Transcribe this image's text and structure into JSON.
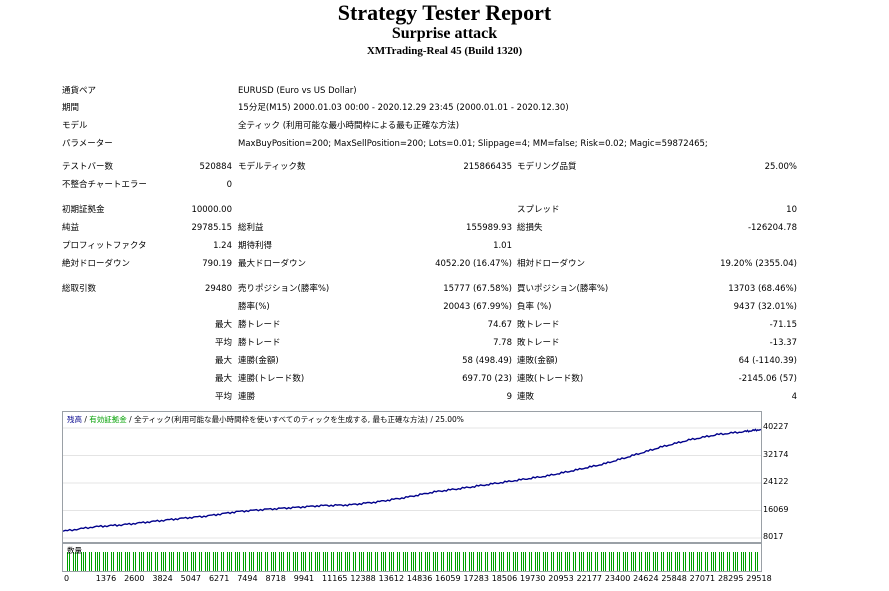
{
  "header": {
    "title": "Strategy Tester Report",
    "subtitle": "Surprise attack",
    "build": "XMTrading-Real 45 (Build 1320)"
  },
  "settings": {
    "symbol_label": "通貨ペア",
    "symbol_value": "EURUSD (Euro vs US Dollar)",
    "period_label": "期間",
    "period_value": "15分足(M15) 2000.01.03 00:00 - 2020.12.29 23:45 (2000.01.01 - 2020.12.30)",
    "model_label": "モデル",
    "model_value": "全ティック (利用可能な最小時間枠による最も正確な方法)",
    "params_label": "パラメーター",
    "params_value": "MaxBuyPosition=200; MaxSellPosition=200; Lots=0.01; Slippage=4; MM=false; Risk=0.02; Magic=59872465;"
  },
  "stats": {
    "bars_label": "テストバー数",
    "bars_value": "520884",
    "ticks_label": "モデルティック数",
    "ticks_value": "215866435",
    "quality_label": "モデリング品質",
    "quality_value": "25.00%",
    "mismatch_label": "不整合チャートエラー",
    "mismatch_value": "0",
    "deposit_label": "初期証拠金",
    "deposit_value": "10000.00",
    "spread_label": "スプレッド",
    "spread_value": "10",
    "netprofit_label": "純益",
    "netprofit_value": "29785.15",
    "grossprofit_label": "総利益",
    "grossprofit_value": "155989.93",
    "grossloss_label": "総損失",
    "grossloss_value": "-126204.78",
    "pf_label": "プロフィットファクタ",
    "pf_value": "1.24",
    "expected_label": "期待利得",
    "expected_value": "1.01",
    "absdd_label": "絶対ドローダウン",
    "absdd_value": "790.19",
    "maxdd_label": "最大ドローダウン",
    "maxdd_value": "4052.20 (16.47%)",
    "reldd_label": "相対ドローダウン",
    "reldd_value": "19.20% (2355.04)",
    "trades_label": "総取引数",
    "trades_value": "29480",
    "short_label": "売りポジション(勝率%)",
    "short_value": "15777 (67.58%)",
    "long_label": "買いポジション(勝率%)",
    "long_value": "13703 (68.46%)",
    "winrate_label": "勝率(%)",
    "winrate_value": "20043 (67.99%)",
    "lossrate_label": "負率 (%)",
    "lossrate_value": "9437 (32.01%)",
    "pre_max": "最大",
    "pre_avg": "平均",
    "largest_win_label": "勝トレード",
    "largest_win_value": "74.67",
    "largest_loss_label": "敗トレード",
    "largest_loss_value": "-71.15",
    "avg_win_label": "勝トレード",
    "avg_win_value": "7.78",
    "avg_loss_label": "敗トレード",
    "avg_loss_value": "-13.37",
    "max_consec_wins_label": "連勝(金額)",
    "max_consec_wins_value": "58 (498.49)",
    "max_consec_losses_label": "連敗(金額)",
    "max_consec_losses_value": "64 (-1140.39)",
    "max_consec_profit_label": "連勝(トレード数)",
    "max_consec_profit_value": "697.70 (23)",
    "max_consec_loss_label": "連敗(トレード数)",
    "max_consec_loss_value": "-2145.06 (57)",
    "avg_consec_wins_label": "連勝",
    "avg_consec_wins_value": "9",
    "avg_consec_losses_label": "連敗",
    "avg_consec_losses_value": "4"
  },
  "chart_legend": {
    "balance": "残高",
    "sep1": " / ",
    "equity": "有効証拠金",
    "sep2": " / ",
    "model": "全ティック(利用可能な最小時間枠を使いすべてのティックを生成する, 最も正確な方法)",
    "sep3": " / ",
    "quality": "25.00%"
  },
  "volume_label": "数量",
  "colors": {
    "balance": "#00008b",
    "volume": "#00a000",
    "border": "#9aa0a6"
  },
  "chart_data": {
    "type": "line",
    "series": [
      {
        "name": "残高",
        "x": [
          0,
          1376,
          2600,
          3824,
          5047,
          6271,
          7494,
          8718,
          9941,
          11165,
          12388,
          13612,
          14836,
          16059,
          17283,
          18506,
          19730,
          20953,
          22177,
          23400,
          24624,
          25848,
          27071,
          28295,
          29518,
          30200
        ],
        "y": [
          10000,
          11300,
          11900,
          12800,
          13700,
          14500,
          15700,
          16400,
          16900,
          17500,
          17700,
          18600,
          19900,
          21500,
          22600,
          23800,
          25000,
          26200,
          27900,
          29700,
          32100,
          34600,
          36700,
          38300,
          39200,
          39785
        ]
      }
    ],
    "yticks": [
      "40227",
      "32174",
      "24122",
      "16069",
      "8017"
    ],
    "ylim": [
      8017,
      40227
    ],
    "xticks": [
      "0",
      "1376",
      "2600",
      "3824",
      "5047",
      "6271",
      "7494",
      "8718",
      "9941",
      "11165",
      "12388",
      "13612",
      "14836",
      "16059",
      "17283",
      "18506",
      "19730",
      "20953",
      "22177",
      "23400",
      "24624",
      "25848",
      "27071",
      "28295",
      "29518"
    ],
    "xlim": [
      0,
      30200
    ],
    "grid": true
  }
}
